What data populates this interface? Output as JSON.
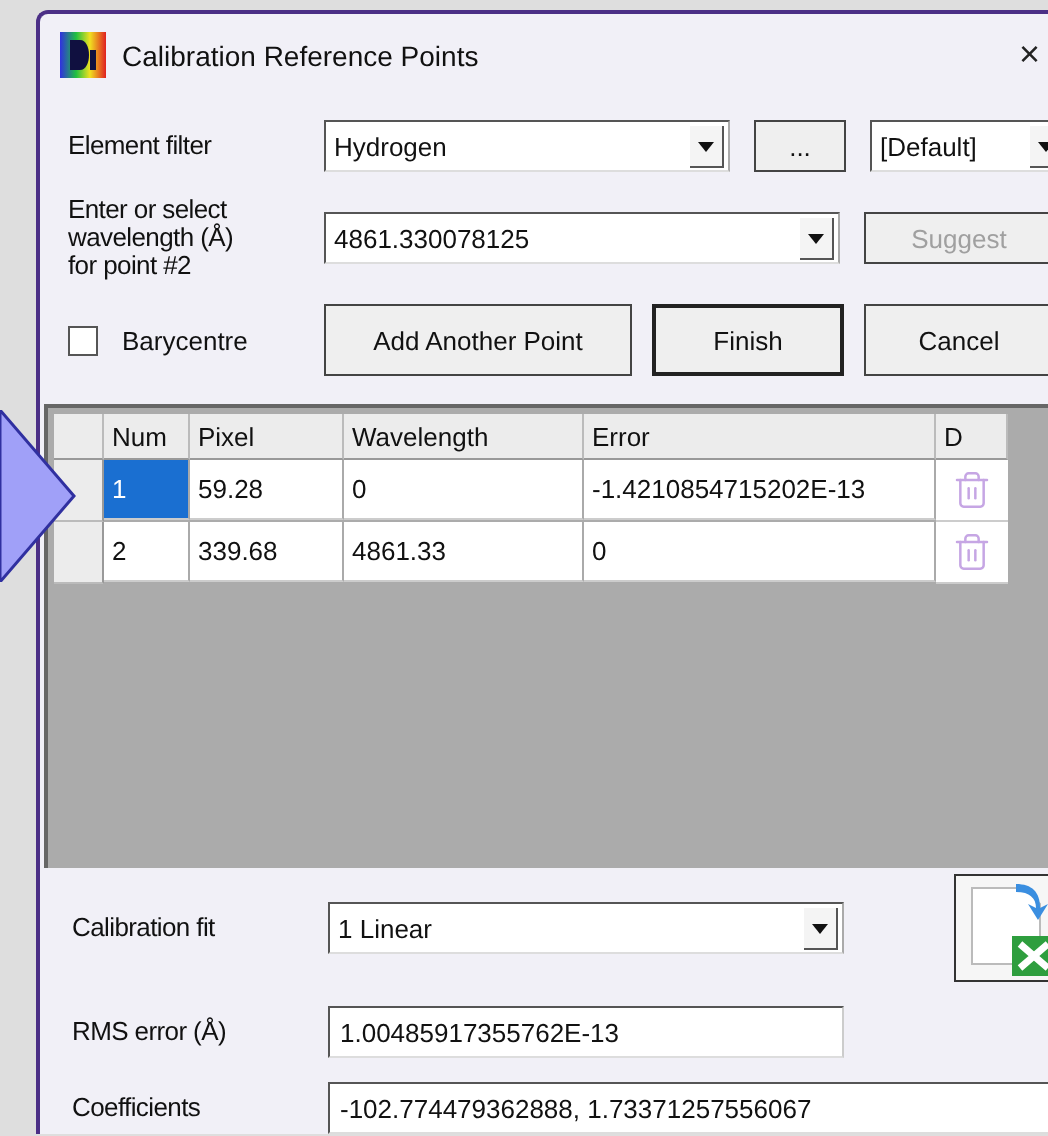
{
  "window": {
    "title": "Calibration Reference Points",
    "close": "×"
  },
  "element_filter": {
    "label": "Element filter",
    "value": "Hydrogen",
    "browse": "...",
    "preset": "[Default]"
  },
  "wavelength": {
    "label": "Enter or select\nwavelength (Å)\nfor point #2",
    "value": "4861.330078125",
    "suggest": {
      "label": "Suggest",
      "disabled": true
    }
  },
  "barycentre": {
    "label": "Barycentre",
    "checked": false
  },
  "buttons": [
    {
      "label": "Add Another Point",
      "default": false
    },
    {
      "label": "Finish",
      "default": true
    },
    {
      "label": "Cancel",
      "default": false
    }
  ],
  "table": {
    "columns": [
      "Num",
      "Pixel",
      "Wavelength",
      "Error",
      "D"
    ],
    "rows": [
      {
        "cells": [
          "1",
          "59.28",
          "0",
          "-1.4210854715202E-13"
        ],
        "selected": true
      },
      {
        "cells": [
          "2",
          "339.68",
          "4861.33",
          "0"
        ],
        "selected": false
      }
    ]
  },
  "fit": {
    "label": "Calibration fit",
    "value": "1 Linear"
  },
  "rms": {
    "label": "RMS error (Å)",
    "value": "1.00485917355762E-13"
  },
  "coefficients": {
    "label": "Coefficients",
    "value": "-102.774479362888, 1.73371257556067"
  }
}
